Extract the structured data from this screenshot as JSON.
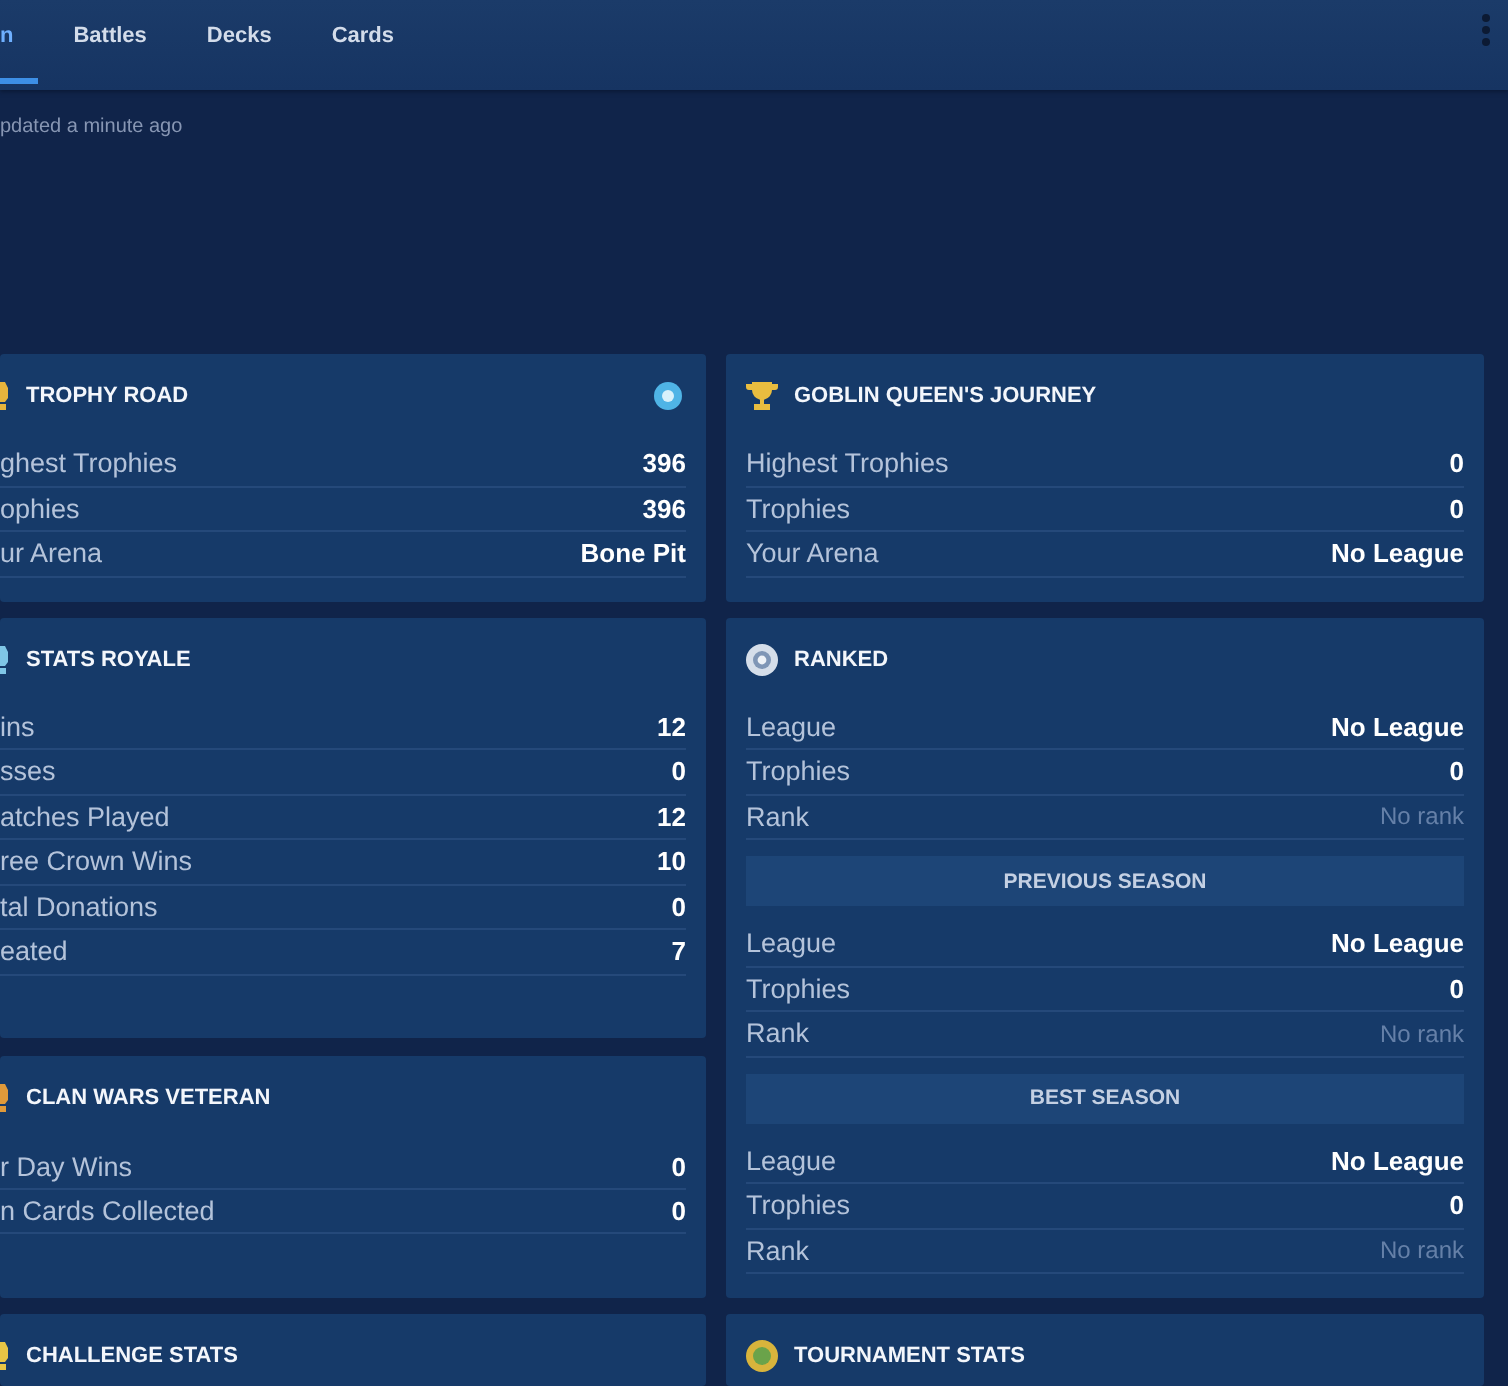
{
  "tabs": [
    {
      "label": "n",
      "selected": true
    },
    {
      "label": "Battles",
      "selected": false
    },
    {
      "label": "Decks",
      "selected": false
    },
    {
      "label": "Cards",
      "selected": false
    }
  ],
  "updated": "pdated a minute ago",
  "rows": [
    {
      "left": [
        {
          "title": "TROPHY ROAD",
          "stats": [
            {
              "label": "ghest Trophies",
              "value": "396",
              "muted": false
            },
            {
              "label": "ophies",
              "value": "396",
              "muted": false
            },
            {
              "label": "ur Arena",
              "value": "Bone Pit",
              "muted": false
            }
          ]
        }
      ],
      "right": [
        {
          "title": "GOBLIN QUEEN'S JOURNEY",
          "stats": [
            {
              "label": "Highest Trophies",
              "value": "0",
              "muted": false
            },
            {
              "label": "Trophies",
              "value": "0",
              "muted": false
            },
            {
              "label": "Your Arena",
              "value": "No League",
              "muted": false
            }
          ]
        }
      ]
    },
    {
      "left": [
        {
          "title": "STATS ROYALE",
          "stats": [
            {
              "label": "ins",
              "value": "12",
              "muted": false
            },
            {
              "label": "sses",
              "value": "0",
              "muted": false
            },
            {
              "label": "atches Played",
              "value": "12",
              "muted": false
            },
            {
              "label": "ree Crown Wins",
              "value": "10",
              "muted": false
            },
            {
              "label": "tal Donations",
              "value": "0",
              "muted": false
            },
            {
              "label": "eated",
              "value": "7",
              "muted": false
            }
          ]
        },
        {
          "title": "CLAN WARS VETERAN",
          "stats": [
            {
              "label": "r Day Wins",
              "value": "0",
              "muted": false
            },
            {
              "label": "n Cards Collected",
              "value": "0",
              "muted": false
            }
          ]
        }
      ],
      "right": [
        {
          "title": "RANKED",
          "stats": [
            {
              "label": "League",
              "value": "No League",
              "muted": false
            },
            {
              "label": "Trophies",
              "value": "0",
              "muted": false
            },
            {
              "label": "Rank",
              "value": "No rank",
              "muted": true
            }
          ],
          "sections": [
            {
              "title": "PREVIOUS SEASON",
              "stats": [
                {
                  "label": "League",
                  "value": "No League",
                  "muted": false
                },
                {
                  "label": "Trophies",
                  "value": "0",
                  "muted": false
                },
                {
                  "label": "Rank",
                  "value": "No rank",
                  "muted": true
                }
              ]
            },
            {
              "title": "BEST SEASON",
              "stats": [
                {
                  "label": "League",
                  "value": "No League",
                  "muted": false
                },
                {
                  "label": "Trophies",
                  "value": "0",
                  "muted": false
                },
                {
                  "label": "Rank",
                  "value": "No rank",
                  "muted": true
                }
              ]
            }
          ]
        }
      ]
    },
    {
      "left": [
        {
          "title": "CHALLENGE STATS"
        }
      ],
      "right": [
        {
          "title": "TOURNAMENT STATS"
        }
      ]
    }
  ]
}
